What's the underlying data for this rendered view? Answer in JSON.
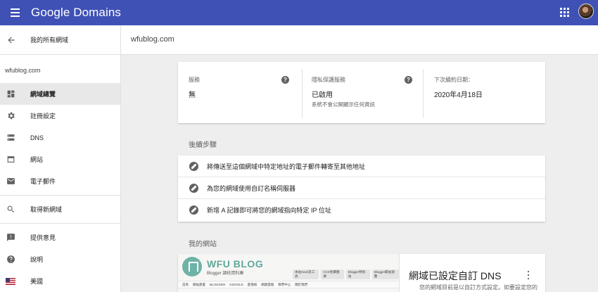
{
  "appbar": {
    "brand": "Google Domains"
  },
  "sidebar": {
    "back_label": "我的所有網域",
    "domain": "wfublog.com",
    "items": [
      {
        "label": "網域總覽",
        "icon": "dashboard-icon",
        "active": true
      },
      {
        "label": "註冊設定",
        "icon": "gear-icon",
        "active": false
      },
      {
        "label": "DNS",
        "icon": "dns-icon",
        "active": false
      },
      {
        "label": "網站",
        "icon": "website-icon",
        "active": false
      },
      {
        "label": "電子郵件",
        "icon": "mail-icon",
        "active": false
      }
    ],
    "items2": [
      {
        "label": "取得新網域",
        "icon": "search-icon"
      }
    ],
    "items3": [
      {
        "label": "提供意見",
        "icon": "feedback-icon"
      },
      {
        "label": "說明",
        "icon": "help-icon"
      },
      {
        "label": "美國",
        "icon": "us-flag-icon"
      }
    ]
  },
  "main": {
    "title": "wfublog.com",
    "summary": {
      "service_label": "服務",
      "service_value": "無",
      "privacy_label": "隱私保護服務",
      "privacy_value": "已啟用",
      "privacy_sub": "系統不會公開顯示任何資訊",
      "renew_label": "下次續約日期：",
      "renew_value": "2020年4月18日"
    },
    "next_steps_title": "後續步驟",
    "next_steps": [
      "將傳送至這個網域中特定地址的電子郵件轉寄至其他地址",
      "為您的網域使用自訂名稱伺服器",
      "新增 A 記錄即可將您的網域指向特定 IP 位址"
    ],
    "website_title": "我的網站",
    "website": {
      "heading": "網域已設定自訂 DNS",
      "desc": "您的網域目前是以自訂方式設定。如要設定您的",
      "thumb_title": "WFU BLOG",
      "thumb_sub": "Blogger 調校資料庫",
      "thumb_tags": [
        "本站Hack及工具",
        "CCS免費圖庫",
        "Blogger特效站",
        "Blogger範站瀏覽"
      ],
      "thumb_nav": [
        "首頁",
        "網站建置",
        "BLOGGER",
        "GOOGLE",
        "部落格",
        "網路雲端",
        "教學中心",
        "關於我們"
      ]
    }
  }
}
